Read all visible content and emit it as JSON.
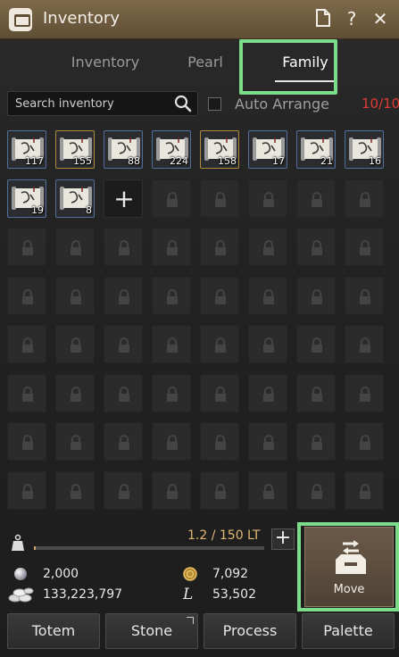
{
  "window": {
    "title": "Inventory"
  },
  "title_icons": [
    {
      "name": "document-icon",
      "glyph": "🗋"
    },
    {
      "name": "help-icon",
      "glyph": "?"
    },
    {
      "name": "close-icon",
      "glyph": "✕"
    }
  ],
  "tabs": [
    {
      "label": "Inventory",
      "active": false
    },
    {
      "label": "Pearl",
      "active": false
    },
    {
      "label": "Family",
      "active": true
    }
  ],
  "search": {
    "placeholder": "Search inventory",
    "value": ""
  },
  "auto_arrange": {
    "label": "Auto Arrange",
    "checked": false
  },
  "slots_count": "10/10",
  "items": [
    {
      "qty": "117",
      "border": "blue"
    },
    {
      "qty": "155",
      "border": "gold"
    },
    {
      "qty": "88",
      "border": "blue"
    },
    {
      "qty": "224",
      "border": "blue"
    },
    {
      "qty": "158",
      "border": "gold"
    },
    {
      "qty": "17",
      "border": "blue"
    },
    {
      "qty": "21",
      "border": "blue"
    },
    {
      "qty": "16",
      "border": "blue"
    },
    {
      "qty": "19",
      "border": "blue"
    },
    {
      "qty": "8",
      "border": "blue"
    }
  ],
  "add_slot_icon": "plus-icon",
  "weight": {
    "text": "1.2 / 150 LT",
    "fraction": 0.008
  },
  "currencies": {
    "silver_pearl": "2,000",
    "gold_coin": "7,092",
    "silver": "133,223,797",
    "loyalty": "53,502",
    "loyalty_glyph": "L"
  },
  "move_button": {
    "label": "Move"
  },
  "bottom_buttons": [
    "Totem",
    "Stone",
    "Process",
    "Palette"
  ],
  "colors": {
    "accent_highlight": "#7cdc8a",
    "slot_count": "#e23b35",
    "weight_text": "#e0b873"
  }
}
